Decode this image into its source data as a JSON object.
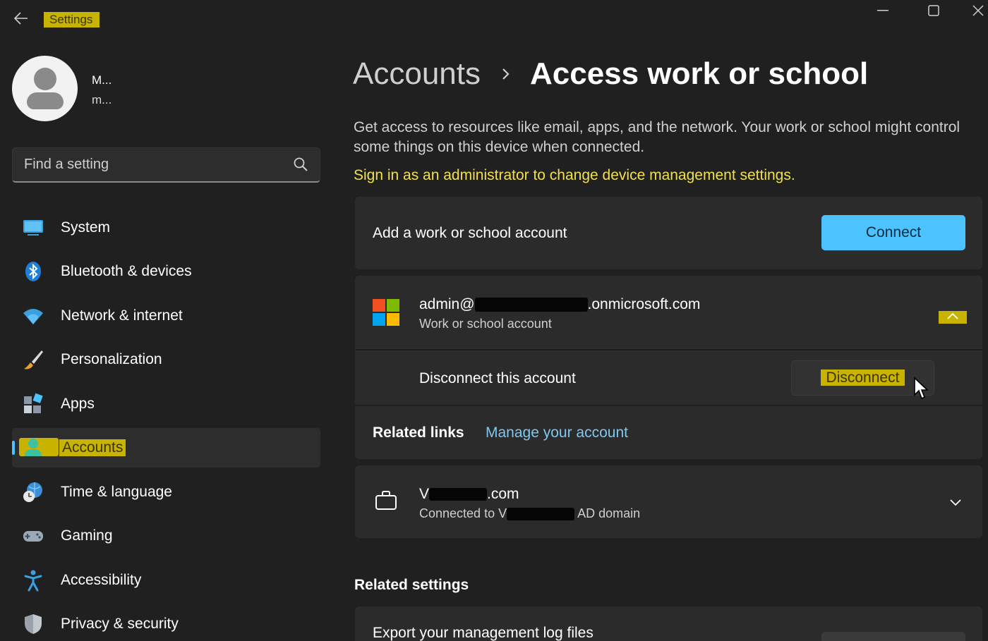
{
  "window": {
    "title": "Settings"
  },
  "profile": {
    "name": "M...",
    "email": "m..."
  },
  "search": {
    "placeholder": "Find a setting"
  },
  "sidebar": {
    "items": [
      {
        "label": "System",
        "icon": "system-icon"
      },
      {
        "label": "Bluetooth & devices",
        "icon": "bluetooth-icon"
      },
      {
        "label": "Network & internet",
        "icon": "wifi-icon"
      },
      {
        "label": "Personalization",
        "icon": "brush-icon"
      },
      {
        "label": "Apps",
        "icon": "apps-icon"
      },
      {
        "label": "Accounts",
        "icon": "accounts-icon",
        "active": true
      },
      {
        "label": "Time & language",
        "icon": "globe-clock-icon"
      },
      {
        "label": "Gaming",
        "icon": "gamepad-icon"
      },
      {
        "label": "Accessibility",
        "icon": "accessibility-icon"
      },
      {
        "label": "Privacy & security",
        "icon": "shield-icon"
      }
    ]
  },
  "main": {
    "breadcrumb_parent": "Accounts",
    "breadcrumb_current": "Access work or school",
    "description": "Get access to resources like email, apps, and the network. Your work or school might control some things on this device when connected.",
    "admin_notice": "Sign in as an administrator to change device management settings.",
    "add_account": {
      "label": "Add a work or school account",
      "button": "Connect"
    },
    "account": {
      "email_prefix": "admin@",
      "email_suffix": ".onmicrosoft.com",
      "type": "Work or school account",
      "disconnect_label": "Disconnect this account",
      "disconnect_button": "Disconnect",
      "related_links_label": "Related links",
      "manage_link": "Manage your account"
    },
    "domain_account": {
      "name_prefix": "V",
      "name_suffix": ".com",
      "desc_prefix": "Connected to V",
      "desc_suffix": "AD domain"
    },
    "related_settings": {
      "title": "Related settings",
      "export_label": "Export your management log files"
    }
  },
  "colors": {
    "accent": "#4cc2ff",
    "highlight": "#c8b400",
    "warning_text": "#f0e050",
    "background": "#202020",
    "card": "#2b2b2b"
  }
}
